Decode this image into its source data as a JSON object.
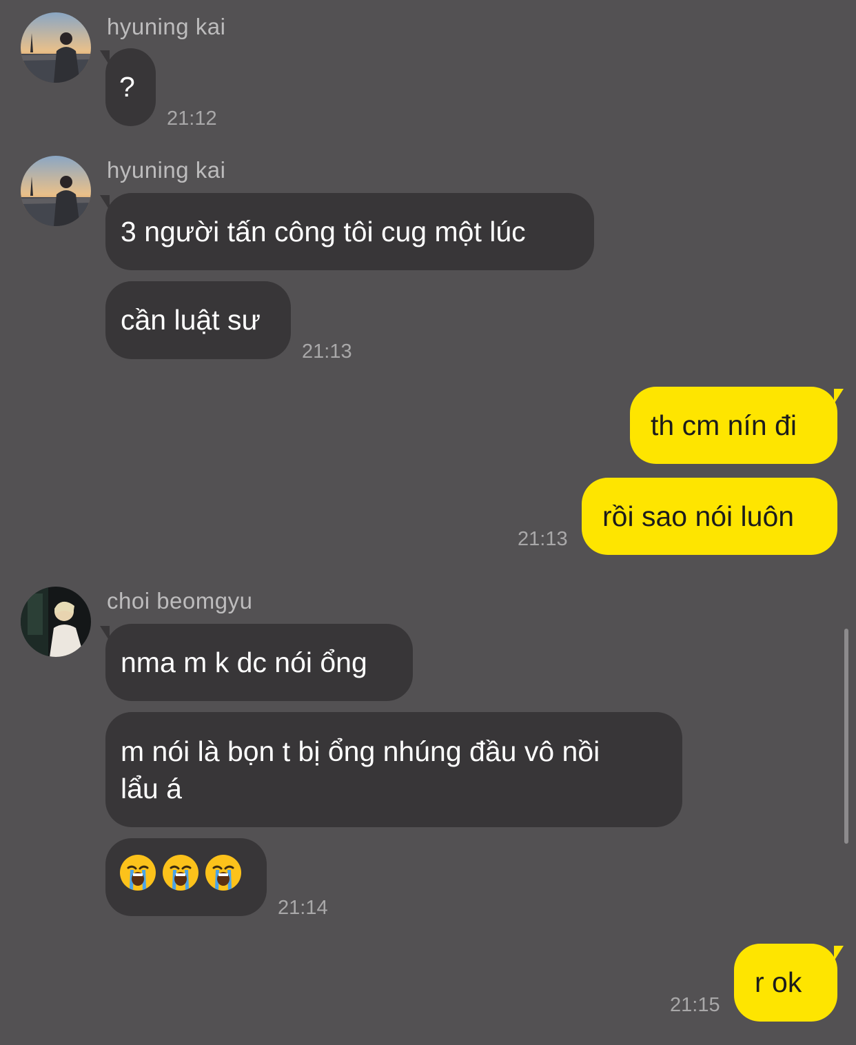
{
  "messages": {
    "g1": {
      "sender": "hyuning kai",
      "b1": "?",
      "time": "21:12"
    },
    "g2": {
      "sender": "hyuning kai",
      "b1": "3 người tấn công tôi cug một lúc",
      "b2": "cần luật sư",
      "time": "21:13"
    },
    "g3": {
      "b1": "th cm nín đi",
      "b2": "rồi sao nói luôn",
      "time": "21:13"
    },
    "g4": {
      "sender": "choi beomgyu",
      "b1": "nma m k dc nói ổng",
      "b2_line1": "m nói là bọn t bị ổng nhúng đầu vô nồi",
      "b2_line2": "lẩu á",
      "b3_emoji": "loudly-crying-face x3",
      "time": "21:14"
    },
    "g5": {
      "b1": "r ok",
      "time": "21:15"
    }
  },
  "colors": {
    "background": "#535153",
    "incoming_bubble": "#383638",
    "outgoing_bubble": "#fee500"
  }
}
